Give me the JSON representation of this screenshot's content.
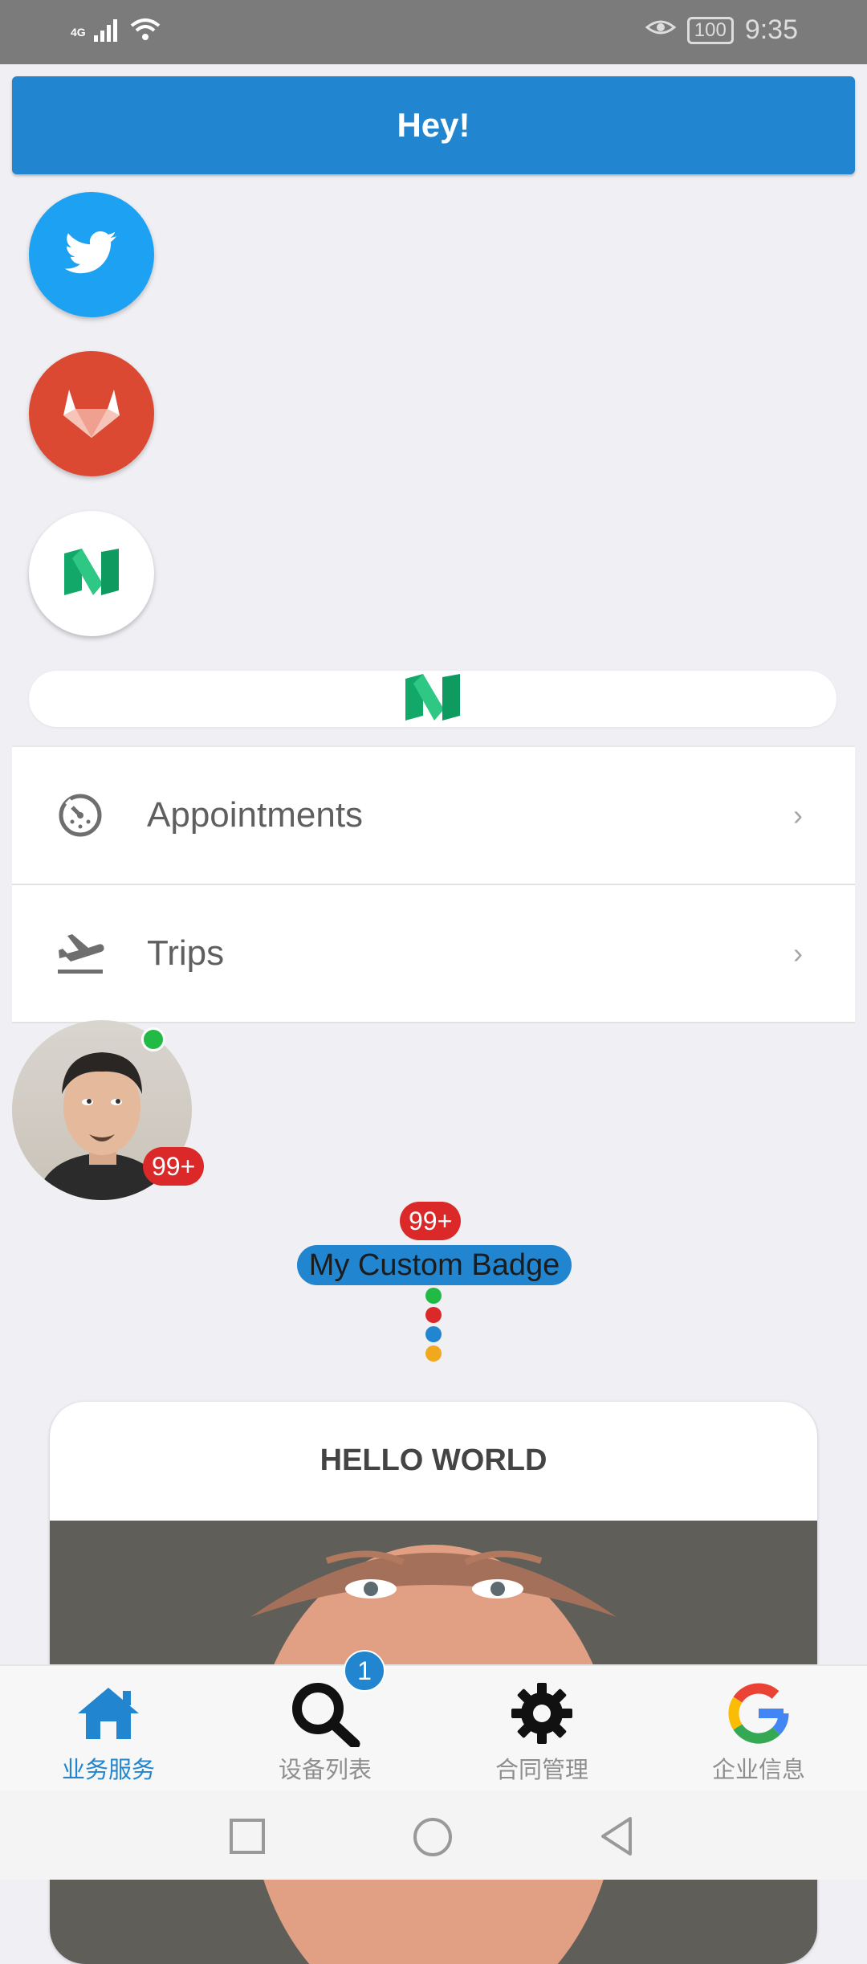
{
  "status_bar": {
    "network": "4G",
    "battery": "100",
    "time": "9:35"
  },
  "header": {
    "button_label": "Hey!"
  },
  "social_buttons": [
    {
      "name": "twitter",
      "icon": "twitter-bird-icon",
      "color": "#1da1f2"
    },
    {
      "name": "gitlab",
      "icon": "gitlab-fox-icon",
      "color": "#db4932"
    },
    {
      "name": "medium",
      "icon": "medium-m-icon",
      "color": "#ffffff"
    }
  ],
  "wide_button": {
    "icon": "medium-m-icon"
  },
  "menu": {
    "items": [
      {
        "label": "Appointments",
        "icon": "clock-dial-icon",
        "chevron": "›"
      },
      {
        "label": "Trips",
        "icon": "plane-departure-icon",
        "chevron": "›"
      }
    ]
  },
  "avatar": {
    "badge": "99+",
    "online": true
  },
  "custom_badge": {
    "count": "99+",
    "label": "My Custom Badge",
    "dots": [
      "#21ba45",
      "#db2828",
      "#2185d0",
      "#f2a81d"
    ]
  },
  "card": {
    "title": "HELLO WORLD"
  },
  "tab_bar": {
    "tabs": [
      {
        "label": "业务服务",
        "icon": "home-icon",
        "active": true
      },
      {
        "label": "设备列表",
        "icon": "search-icon",
        "badge": "1"
      },
      {
        "label": "合同管理",
        "icon": "gear-icon"
      },
      {
        "label": "企业信息",
        "icon": "google-icon"
      }
    ]
  },
  "colors": {
    "primary": "#2185d0",
    "danger": "#db2828",
    "success": "#21ba45"
  }
}
